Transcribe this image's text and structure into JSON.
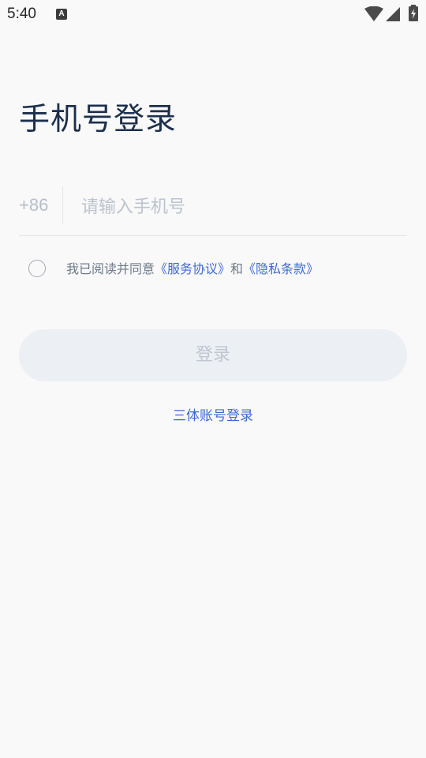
{
  "status_bar": {
    "time": "5:40",
    "notification_icon": "a-icon",
    "icons": [
      "wifi-icon",
      "signal-icon",
      "battery-charging-icon"
    ]
  },
  "login": {
    "title": "手机号登录",
    "country_code": "+86",
    "phone_placeholder": "请输入手机号",
    "phone_value": "",
    "agreement": {
      "checked": false,
      "prefix": "我已阅读并同意",
      "service_link": "《服务协议》",
      "conjunction": "和",
      "privacy_link": "《隐私条款》"
    },
    "login_button_label": "登录",
    "alt_login_label": "三体账号登录"
  },
  "colors": {
    "background": "#f9f9f9",
    "title": "#1c2f4c",
    "link": "#3e6ad1",
    "button_disabled_bg": "#eceff4",
    "button_disabled_text": "#bfc6d1",
    "placeholder": "#bcc3ce"
  }
}
